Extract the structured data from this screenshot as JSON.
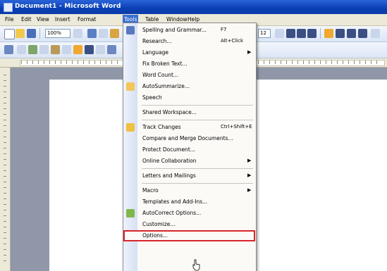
{
  "window": {
    "title": "Document1 - Microsoft Word"
  },
  "menubar": {
    "items": [
      {
        "label": "File"
      },
      {
        "label": "Edit"
      },
      {
        "label": "View"
      },
      {
        "label": "Insert"
      },
      {
        "label": "Format"
      },
      {
        "label": "Tools"
      },
      {
        "label": "Table"
      },
      {
        "label": "Window"
      },
      {
        "label": "Help"
      }
    ],
    "active": "Tools"
  },
  "toolbar": {
    "zoom": "100%",
    "font_size": "12"
  },
  "tools_menu": {
    "items": [
      {
        "label": "Spelling and Grammar...",
        "shortcut": "F7",
        "icon": "spelling-icon"
      },
      {
        "label": "Research...",
        "shortcut": "Alt+Click",
        "icon": ""
      },
      {
        "label": "Language",
        "submenu": true
      },
      {
        "label": "Fix Broken Text..."
      },
      {
        "label": "Word Count..."
      },
      {
        "label": "AutoSummarize...",
        "icon": "autosummarize-icon"
      },
      {
        "label": "Speech"
      },
      {
        "label": "Shared Workspace..."
      },
      {
        "label": "Track Changes",
        "shortcut": "Ctrl+Shift+E",
        "icon": "track-changes-icon"
      },
      {
        "label": "Compare and Merge Documents..."
      },
      {
        "label": "Protect Document..."
      },
      {
        "label": "Online Collaboration",
        "submenu": true
      },
      {
        "label": "Letters and Mailings",
        "submenu": true
      },
      {
        "label": "Macro",
        "submenu": true
      },
      {
        "label": "Templates and Add-Ins..."
      },
      {
        "label": "AutoCorrect Options...",
        "icon": "autocorrect-icon"
      },
      {
        "label": "Customize..."
      },
      {
        "label": "Options..."
      }
    ]
  },
  "highlight_color": "#d7242a"
}
